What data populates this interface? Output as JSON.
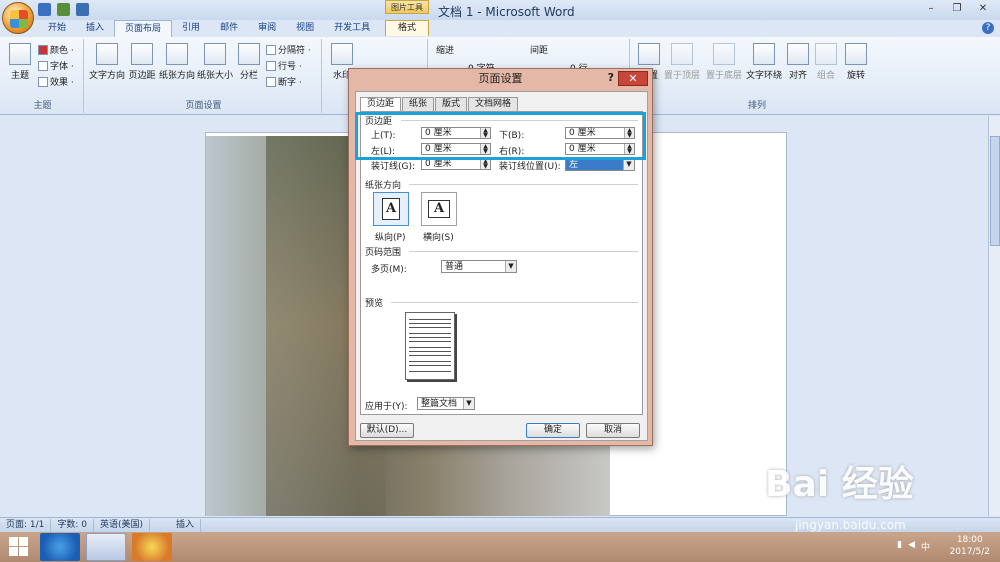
{
  "app": {
    "title": "文档 1 - Microsoft Word",
    "contextual_tab_group": "图片工具",
    "contextual_tab": "格式",
    "window_buttons": [
      "–",
      "❐",
      "✕"
    ]
  },
  "tabs": [
    "开始",
    "插入",
    "页面布局",
    "引用",
    "邮件",
    "审阅",
    "视图",
    "开发工具"
  ],
  "ribbon": {
    "theme_group": {
      "label": "主题",
      "main": "主题",
      "colors": "颜色 ·",
      "fonts": "字体 ·",
      "effects": "效果 ·"
    },
    "page_setup_group": {
      "label": "页面设置",
      "text_direction": "文字方向",
      "margins": "页边距",
      "orientation": "纸张方向",
      "size": "纸张大小",
      "columns": "分栏",
      "breaks": "分隔符 ·",
      "line_numbers": "行号 ·",
      "hyphenation": "断字 ·"
    },
    "background_group": {
      "watermark": "水印"
    },
    "paragraph_group": {
      "indent": "缩进",
      "spacing": "间距",
      "indent_value": "0 字符",
      "spacing_value": "0 行"
    },
    "arrange_group": {
      "label": "排列",
      "position": "位置",
      "bring_front": "置于顶层",
      "send_back": "置于底层",
      "wrap": "文字环绕",
      "align": "对齐",
      "group": "组合",
      "rotate": "旋转"
    }
  },
  "dialog": {
    "title": "页面设置",
    "help": "?",
    "close": "✕",
    "tabs": [
      "页边距",
      "纸张",
      "版式",
      "文档网格"
    ],
    "margins_section": "页边距",
    "top_label": "上(T):",
    "top_value": "0 厘米",
    "bottom_label": "下(B):",
    "bottom_value": "0 厘米",
    "left_label": "左(L):",
    "left_value": "0 厘米",
    "right_label": "右(R):",
    "right_value": "0 厘米",
    "gutter_label": "装订线(G):",
    "gutter_value": "0 厘米",
    "gutter_pos_label": "装订线位置(U):",
    "gutter_pos_value": "左",
    "orientation_section": "纸张方向",
    "portrait": "纵向(P)",
    "landscape": "横向(S)",
    "pages_section": "页码范围",
    "multi_pages_label": "多页(M):",
    "multi_pages_value": "普通",
    "preview_section": "预览",
    "apply_label": "应用于(Y):",
    "apply_value": "整篇文档",
    "default_btn": "默认(D)...",
    "ok_btn": "确定",
    "cancel_btn": "取消"
  },
  "status": {
    "page": "页面: 1/1",
    "words": "字数: 0",
    "language": "英语(美国)",
    "mode": "插入"
  },
  "taskbar": {
    "time": "18:00",
    "date": "2017/5/2",
    "ime": "中"
  },
  "watermark": {
    "brand": "Bai 经验",
    "url": "jingyan.baidu.com"
  },
  "colors": {
    "highlight": "#1aa3d9",
    "dialog_frame": "#e5b7a6",
    "close": "#c8453a",
    "ribbon": "#dbe6f4"
  }
}
